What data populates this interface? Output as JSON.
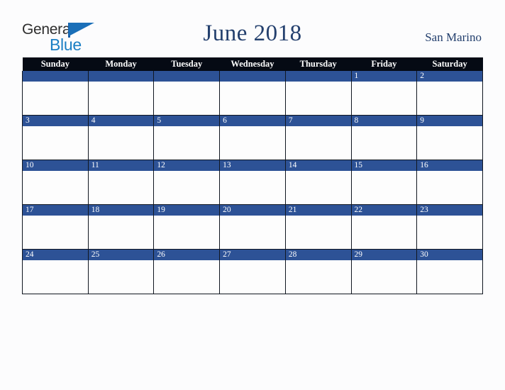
{
  "logo": {
    "word_top": "General",
    "word_bottom": "Blue",
    "triangle_icon": "triangle-icon",
    "color_top": "#2e2e2e",
    "color_bottom": "#1b7fc4",
    "color_triangle": "#1a6fb8"
  },
  "header": {
    "title": "June 2018",
    "region": "San Marino",
    "title_color": "#24406e"
  },
  "calendar": {
    "month": "June",
    "year": "2018",
    "weekday_headers": [
      "Sunday",
      "Monday",
      "Tuesday",
      "Wednesday",
      "Thursday",
      "Friday",
      "Saturday"
    ],
    "header_bg": "#050a14",
    "daynum_bg": "#2d5296",
    "cell_bg": "#fdfdfd",
    "border_color": "#101620",
    "weeks": [
      [
        "",
        "",
        "",
        "",
        "",
        "1",
        "2"
      ],
      [
        "3",
        "4",
        "5",
        "6",
        "7",
        "8",
        "9"
      ],
      [
        "10",
        "11",
        "12",
        "13",
        "14",
        "15",
        "16"
      ],
      [
        "17",
        "18",
        "19",
        "20",
        "21",
        "22",
        "23"
      ],
      [
        "24",
        "25",
        "26",
        "27",
        "28",
        "29",
        "30"
      ]
    ]
  }
}
